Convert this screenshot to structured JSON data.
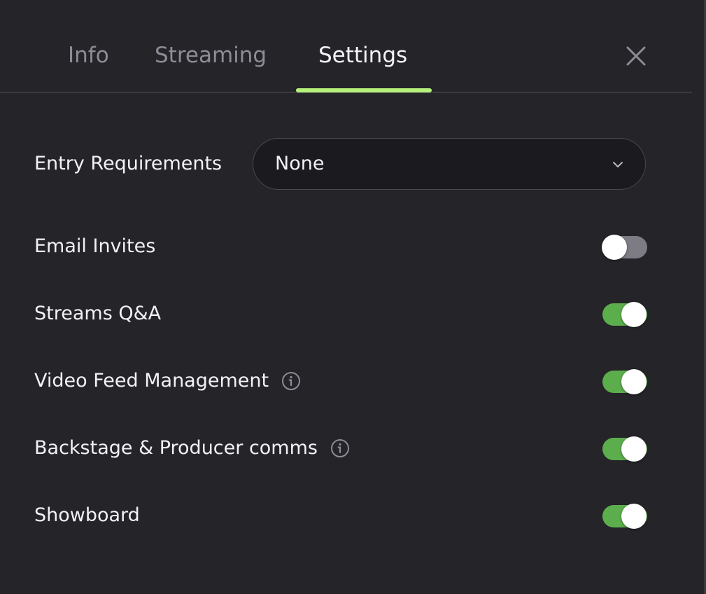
{
  "tabs": [
    {
      "label": "Info",
      "active": false
    },
    {
      "label": "Streaming",
      "active": false
    },
    {
      "label": "Settings",
      "active": true
    }
  ],
  "colors": {
    "background": "#252429",
    "accent_underline": "#b6f27b",
    "toggle_on": "#5cae4d",
    "toggle_off": "#7d7c84"
  },
  "entry_requirements": {
    "label": "Entry Requirements",
    "value": "None"
  },
  "settings": [
    {
      "label": "Email Invites",
      "enabled": false,
      "info_icon": false
    },
    {
      "label": "Streams Q&A",
      "enabled": true,
      "info_icon": false
    },
    {
      "label": "Video Feed Management",
      "enabled": true,
      "info_icon": true
    },
    {
      "label": "Backstage & Producer comms",
      "enabled": true,
      "info_icon": true
    },
    {
      "label": "Showboard",
      "enabled": true,
      "info_icon": false
    }
  ]
}
